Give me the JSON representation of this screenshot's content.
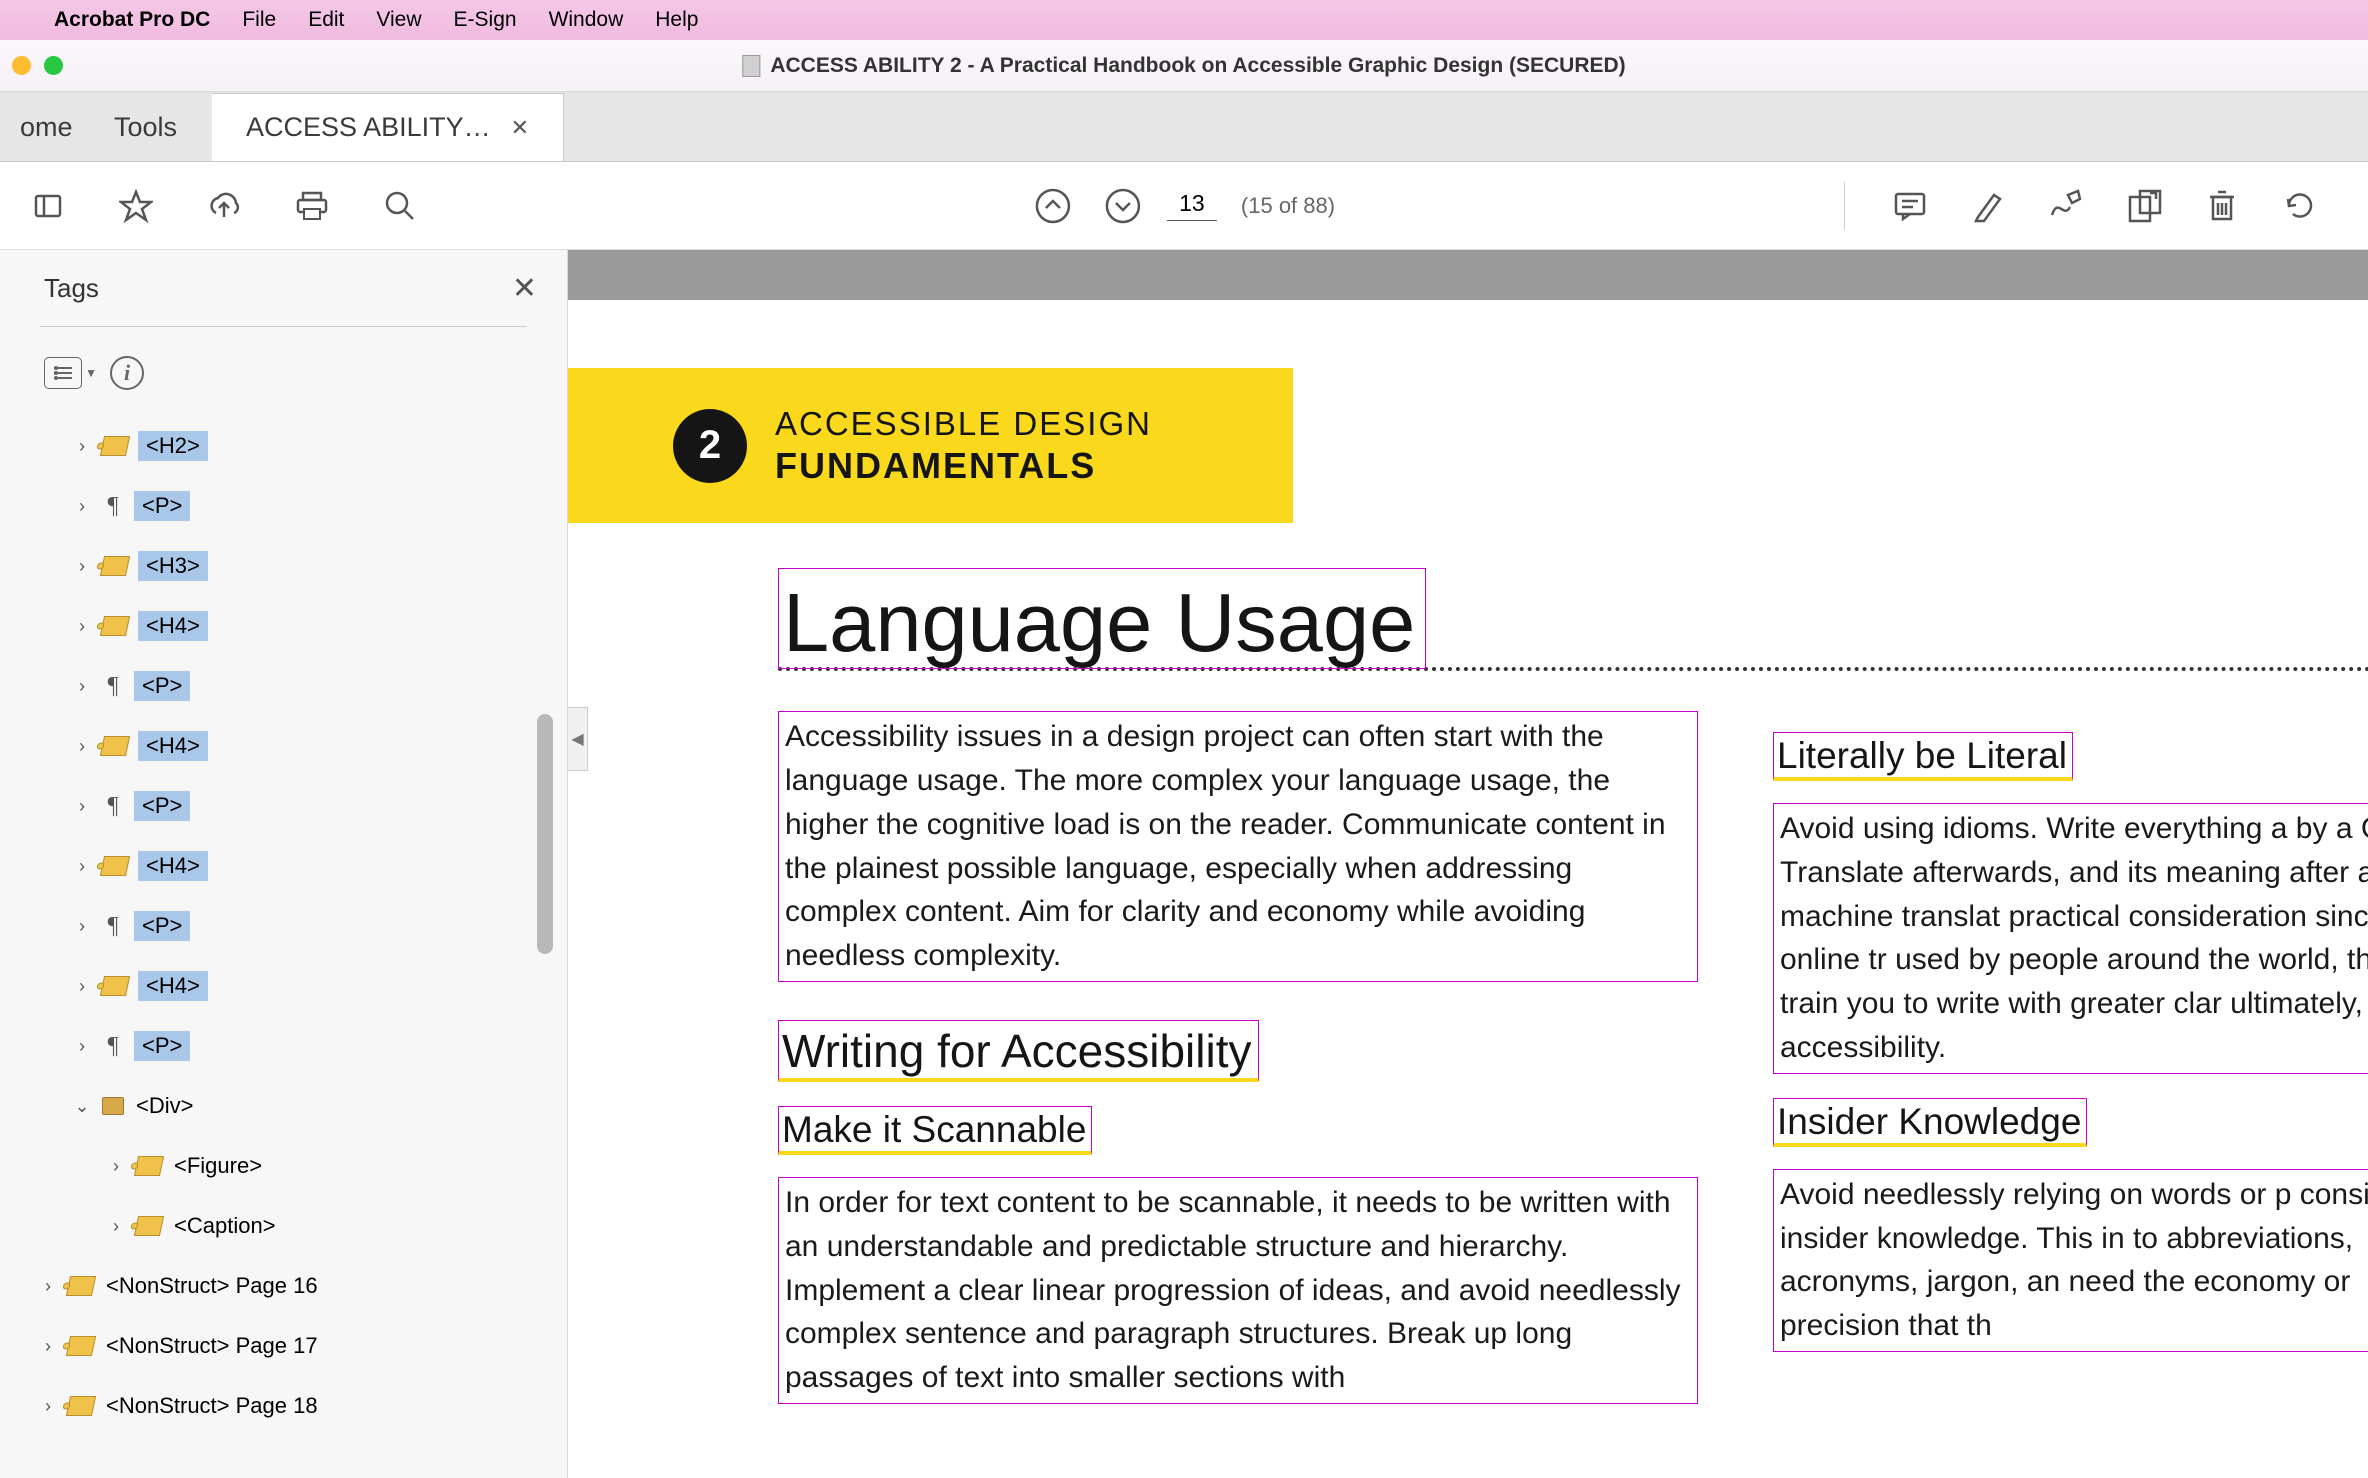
{
  "mac_menu": {
    "app_name": "Acrobat Pro DC",
    "items": [
      "File",
      "Edit",
      "View",
      "E-Sign",
      "Window",
      "Help"
    ]
  },
  "window": {
    "title": "ACCESS ABILITY 2 - A Practical Handbook on Accessible Graphic Design (SECURED)"
  },
  "tabs": {
    "home": "ome",
    "tools": "Tools",
    "doc": "ACCESS ABILITY…"
  },
  "toolbar": {
    "page_num": "13",
    "page_count": "(15 of 88)"
  },
  "tags_panel": {
    "title": "Tags",
    "tree": [
      {
        "indent": 1,
        "expand": "closed",
        "icon": "tag",
        "label": "<H2>",
        "boxed": true
      },
      {
        "indent": 1,
        "expand": "closed",
        "icon": "p",
        "label": "<P>",
        "boxed": true
      },
      {
        "indent": 1,
        "expand": "closed",
        "icon": "tag",
        "label": "<H3>",
        "boxed": true
      },
      {
        "indent": 1,
        "expand": "closed",
        "icon": "tag",
        "label": "<H4>",
        "boxed": true
      },
      {
        "indent": 1,
        "expand": "closed",
        "icon": "p",
        "label": "<P>",
        "boxed": true
      },
      {
        "indent": 1,
        "expand": "closed",
        "icon": "tag",
        "label": "<H4>",
        "boxed": true
      },
      {
        "indent": 1,
        "expand": "closed",
        "icon": "p",
        "label": "<P>",
        "boxed": true
      },
      {
        "indent": 1,
        "expand": "closed",
        "icon": "tag",
        "label": "<H4>",
        "boxed": true
      },
      {
        "indent": 1,
        "expand": "closed",
        "icon": "p",
        "label": "<P>",
        "boxed": true
      },
      {
        "indent": 1,
        "expand": "closed",
        "icon": "tag",
        "label": "<H4>",
        "boxed": true
      },
      {
        "indent": 1,
        "expand": "closed",
        "icon": "p",
        "label": "<P>",
        "boxed": true
      },
      {
        "indent": 1,
        "expand": "open",
        "icon": "folder",
        "label": "<Div>",
        "boxed": false
      },
      {
        "indent": 2,
        "expand": "closed",
        "icon": "tag",
        "label": "<Figure>",
        "boxed": false
      },
      {
        "indent": 2,
        "expand": "closed",
        "icon": "tag",
        "label": "<Caption>",
        "boxed": false
      },
      {
        "indent": 0,
        "expand": "closed",
        "icon": "tag",
        "label": "<NonStruct> Page 16",
        "boxed": false
      },
      {
        "indent": 0,
        "expand": "closed",
        "icon": "tag",
        "label": "<NonStruct> Page 17",
        "boxed": false
      },
      {
        "indent": 0,
        "expand": "closed",
        "icon": "tag",
        "label": "<NonStruct> Page 18",
        "boxed": false
      }
    ]
  },
  "doc": {
    "banner": {
      "num": "2",
      "line1": "ACCESSIBLE DESIGN",
      "line2": "FUNDAMENTALS"
    },
    "title": "Language Usage",
    "intro": "Accessibility issues in a design project can often start with the language usage. The more complex your language usage, the higher the cognitive load is on the reader. Communicate content in the plainest possible language, especially when addressing complex content. Aim for clarity and economy while avoiding needless complexity.",
    "h3_1": "Writing for Accessibility",
    "h4_1": "Make it Scannable",
    "p1": "In order for text content to be scannable, it needs to be written with an understandable and predictable structure and hierarchy. Implement a clear linear progression of ideas, and avoid needlessly complex sentence and paragraph structures. Break up long passages of text into smaller sections with",
    "h4_c2_1": "Literally be Literal",
    "p_c2_1": "Avoid using idioms. Write everything a by a Google Translate afterwards, and its meaning after any machine translat practical consideration since online tr used by people around the world, this can train you to write with greater clar ultimately, accessibility.",
    "h4_c2_2": "Insider Knowledge",
    "p_c2_2": "Avoid needlessly relying on words or p considered insider knowledge. This in to abbreviations, acronyms, jargon, an need the economy or precision that th"
  }
}
